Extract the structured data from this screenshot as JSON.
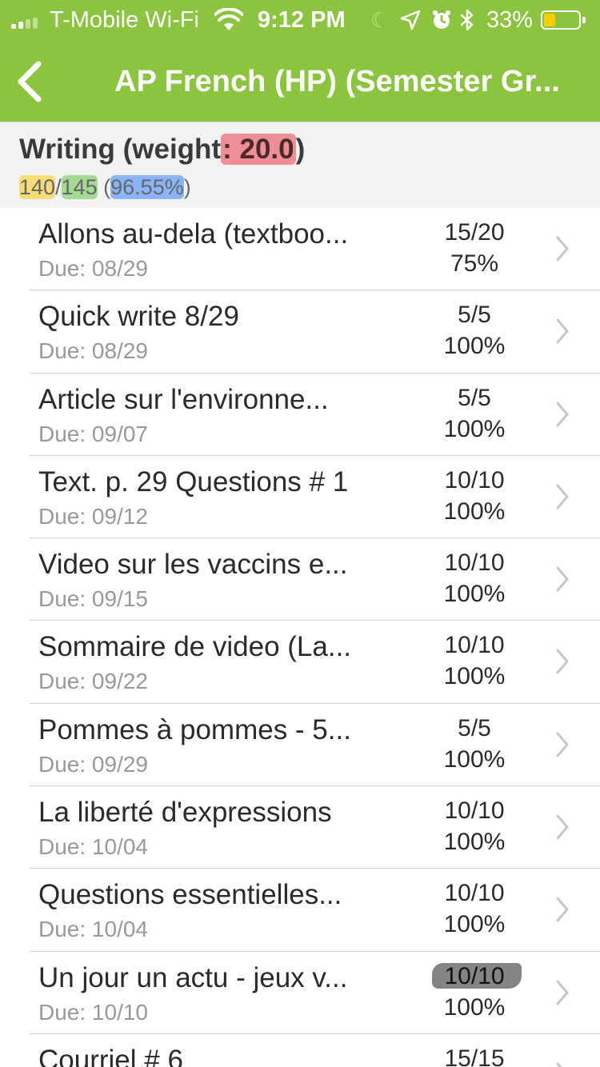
{
  "status_bar": {
    "carrier": "T-Mobile Wi-Fi",
    "time": "9:12 PM",
    "battery_percent": "33%",
    "battery_level": 0.33,
    "battery_color": "#ffcc00",
    "icons": [
      "signal-icon",
      "wifi-icon",
      "moon-icon",
      "location-arrow-icon",
      "alarm-icon",
      "bluetooth-icon",
      "battery-icon"
    ]
  },
  "nav": {
    "title": "AP French (HP) (Semester Gr...",
    "back_icon": "chevron-left-icon",
    "bar_color": "#8bc53f"
  },
  "category": {
    "title_prefix": "Writing (weight",
    "title_weight": ": 20.0",
    "title_suffix": ")",
    "points_earned": "140",
    "slash": "/",
    "points_possible": "145",
    "percent_open": " (",
    "percent": "96.55%",
    "percent_close": ")"
  },
  "assignments": [
    {
      "name": "Allons au-dela (textboo...",
      "due": "Due: 08/29",
      "score": "15/20",
      "percent": "75%"
    },
    {
      "name": "Quick write 8/29",
      "due": "Due: 08/29",
      "score": "5/5",
      "percent": "100%"
    },
    {
      "name": "Article sur l'environne...",
      "due": "Due: 09/07",
      "score": "5/5",
      "percent": "100%"
    },
    {
      "name": "Text. p. 29 Questions # 1",
      "due": "Due: 09/12",
      "score": "10/10",
      "percent": "100%"
    },
    {
      "name": "Video sur les vaccins e...",
      "due": "Due: 09/15",
      "score": "10/10",
      "percent": "100%"
    },
    {
      "name": "Sommaire de video (La...",
      "due": "Due: 09/22",
      "score": "10/10",
      "percent": "100%"
    },
    {
      "name": "Pommes à pommes - 5...",
      "due": "Due: 09/29",
      "score": "5/5",
      "percent": "100%"
    },
    {
      "name": "La liberté d'expressions",
      "due": "Due: 10/04",
      "score": "10/10",
      "percent": "100%"
    },
    {
      "name": "Questions essentielles...",
      "due": "Due: 10/04",
      "score": "10/10",
      "percent": "100%"
    },
    {
      "name": "Un jour un actu - jeux v...",
      "due": "Due: 10/10",
      "score": "10/10",
      "percent": "100%"
    },
    {
      "name": "Courriel # 6",
      "due": "",
      "score": "15/15",
      "percent": ""
    }
  ]
}
